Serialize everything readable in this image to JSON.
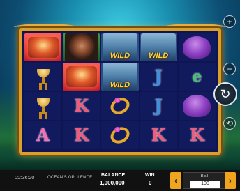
{
  "game": {
    "title": "OCEAN'S OPULENCE",
    "time": "22:36:20",
    "balance_label": "BALANCE:",
    "balance_value": "1,000,000",
    "win_label": "WIN:",
    "win_value": "0",
    "bet_label": "BET:",
    "bet_value": "100",
    "bet_decrease_label": "‹",
    "bet_increase_label": "›"
  },
  "reels": [
    [
      "chest",
      "goblet",
      "goblet",
      "A"
    ],
    [
      "girl",
      "chest",
      "K",
      "K"
    ],
    [
      "wild",
      "wild",
      "ring",
      "ring"
    ],
    [
      "wild",
      "J",
      "J",
      "K"
    ],
    [
      "octopus",
      "e",
      "octopus",
      "K"
    ]
  ],
  "symbols": {
    "wild_text": "WILD",
    "letter_A": "A",
    "letter_K": "K",
    "letter_J": "J",
    "letter_e": "e"
  },
  "controls": {
    "plus_icon": "+",
    "minus_icon": "−",
    "spin_icon": "↻",
    "autoplay_icon": "⟲"
  },
  "colors": {
    "frame_gold": "#d9a02b",
    "bet_button": "#f0a51e",
    "reel_bg": "#121a5e"
  }
}
